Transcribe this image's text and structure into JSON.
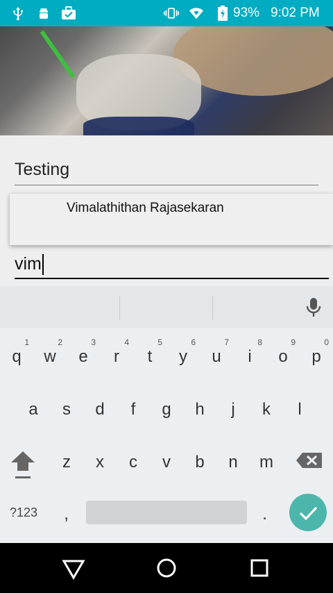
{
  "status_bar": {
    "battery": "93%",
    "time": "9:02 PM",
    "icons": [
      "usb-icon",
      "android-debug-icon",
      "briefcase-check-icon",
      "vibrate-icon",
      "wifi-icon",
      "battery-charging-icon"
    ]
  },
  "form": {
    "title_value": "Testing",
    "name_value": "vim"
  },
  "autocomplete": {
    "suggestion": "Vimalathithan Rajasekaran"
  },
  "keyboard": {
    "row1": [
      {
        "ch": "q",
        "num": "1"
      },
      {
        "ch": "w",
        "num": "2"
      },
      {
        "ch": "e",
        "num": "3"
      },
      {
        "ch": "r",
        "num": "4"
      },
      {
        "ch": "t",
        "num": "5"
      },
      {
        "ch": "y",
        "num": "6"
      },
      {
        "ch": "u",
        "num": "7"
      },
      {
        "ch": "i",
        "num": "8"
      },
      {
        "ch": "o",
        "num": "9"
      },
      {
        "ch": "p",
        "num": "0"
      }
    ],
    "row2": [
      "a",
      "s",
      "d",
      "f",
      "g",
      "h",
      "j",
      "k",
      "l"
    ],
    "row3": [
      "z",
      "x",
      "c",
      "v",
      "b",
      "n",
      "m"
    ],
    "symbols_label": "?123",
    "comma": ",",
    "period": ".",
    "accent_color": "#4db6ac"
  }
}
